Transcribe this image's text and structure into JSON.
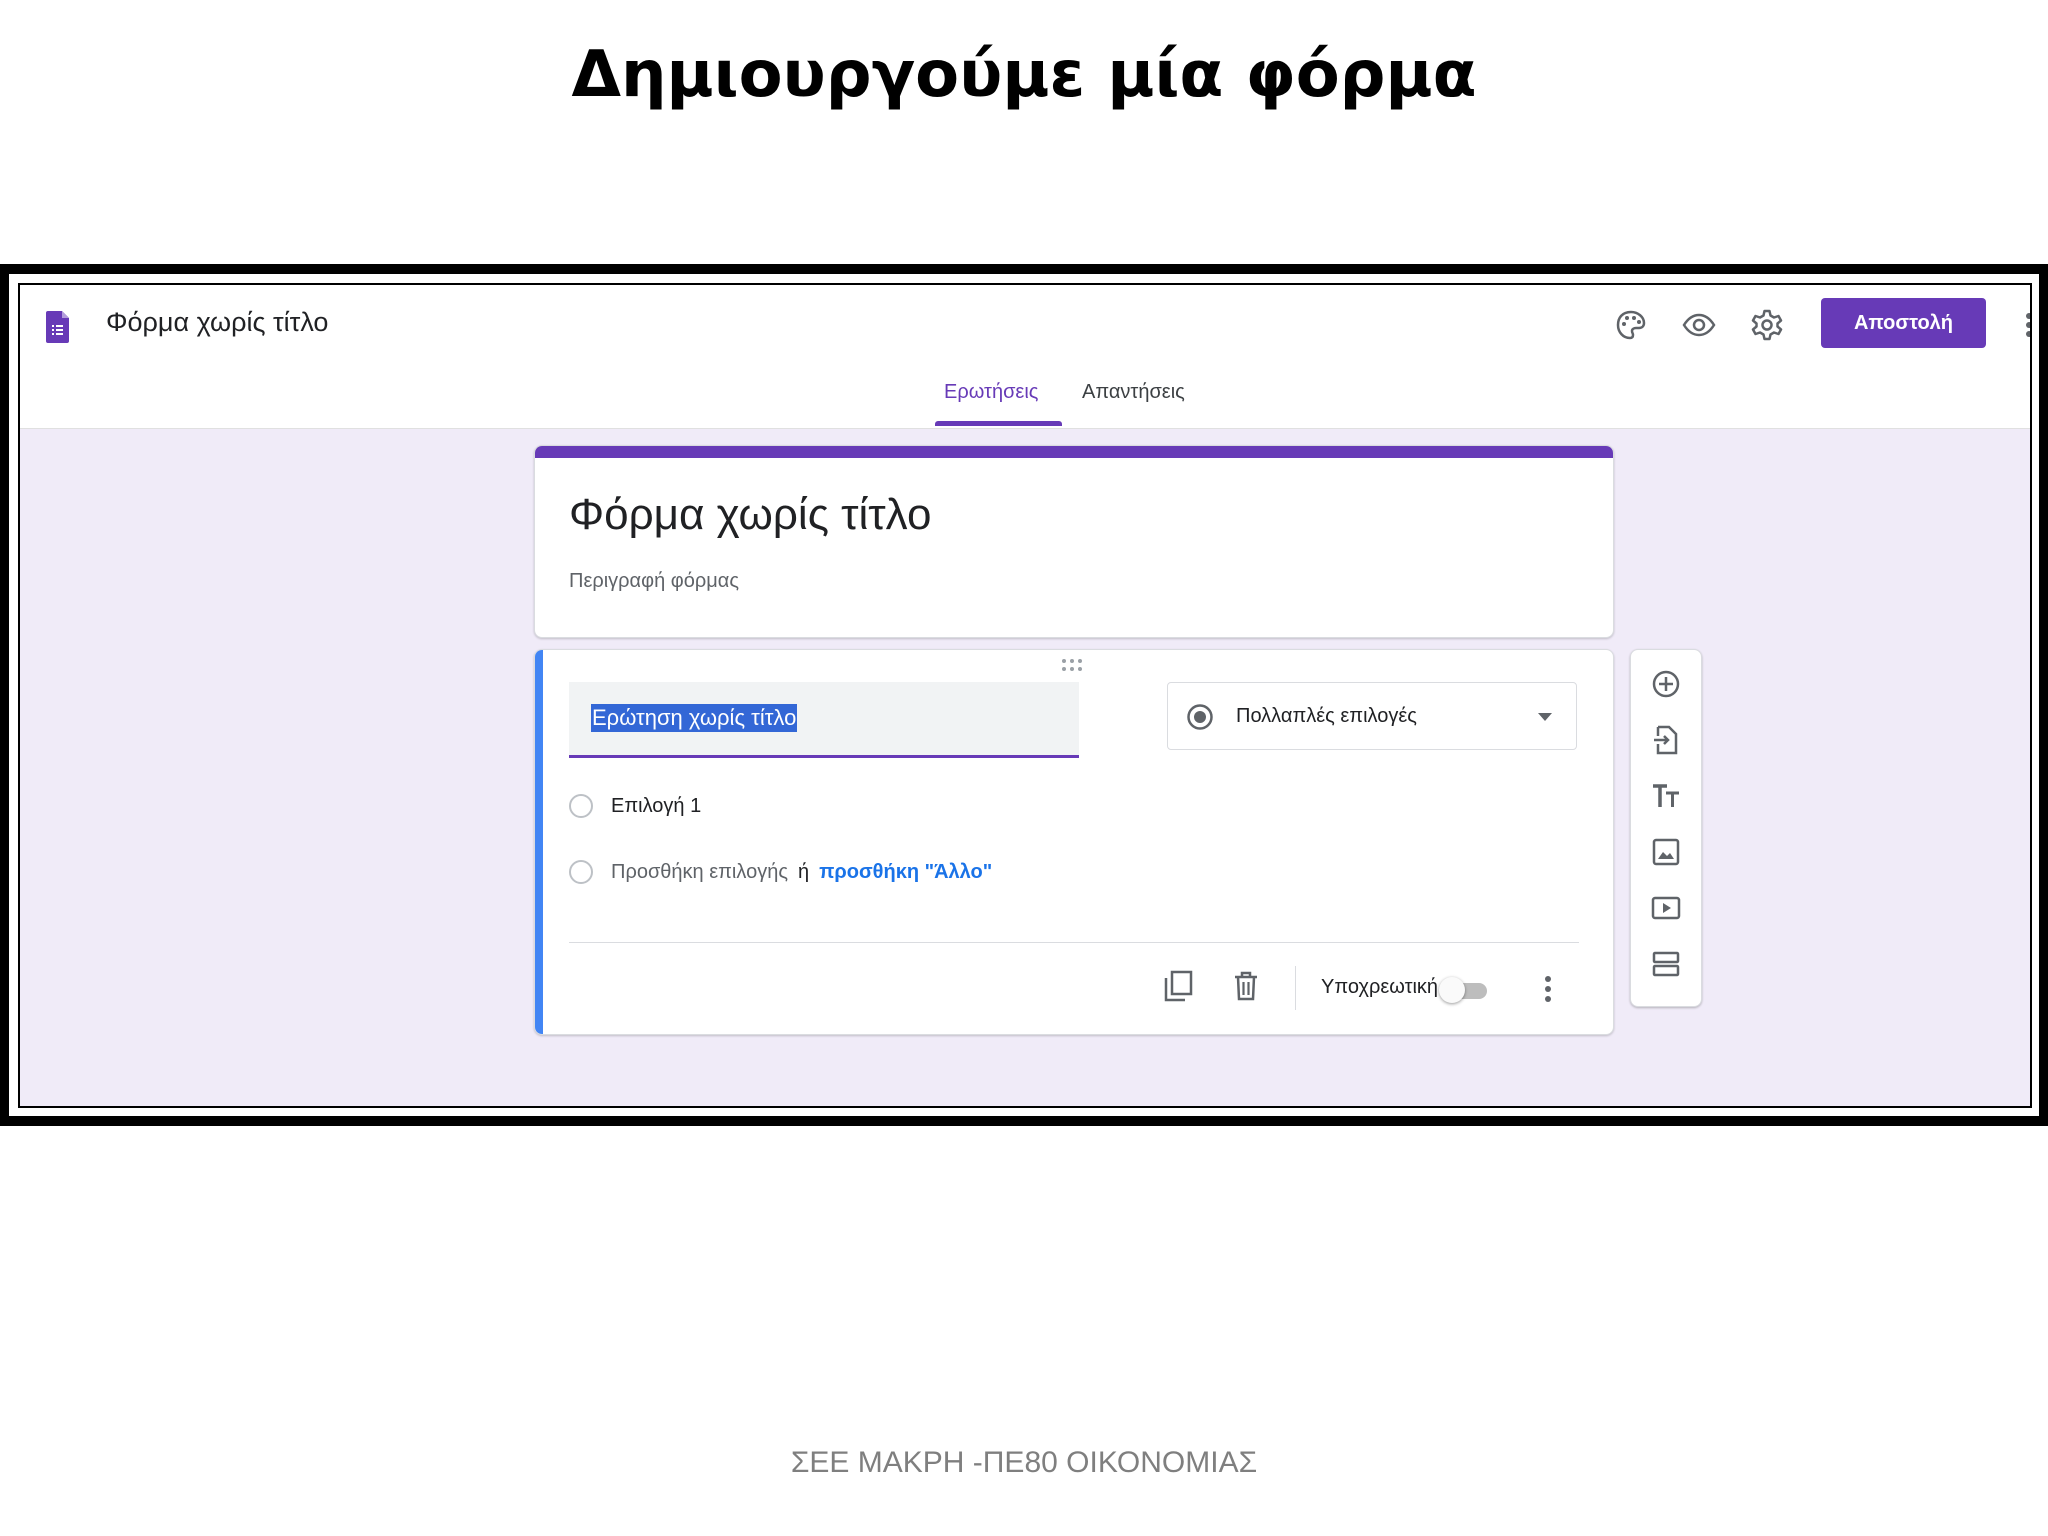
{
  "slide": {
    "title": "Δημιουργούμε μία φόρμα",
    "footer": "ΣΕΕ ΜΑΚΡΗ -ΠΕ80 ΟΙΚΟΝΟΜΙΑΣ"
  },
  "app": {
    "doc_title": "Φόρμα χωρίς τίτλο",
    "send_label": "Αποστολή",
    "accent_color": "#673ab7",
    "header_icons": [
      "palette-icon",
      "preview-eye-icon",
      "settings-gear-icon",
      "more-vert-icon"
    ]
  },
  "tabs": [
    {
      "label": "Ερωτήσεις",
      "active": true
    },
    {
      "label": "Απαντήσεις",
      "active": false
    }
  ],
  "form": {
    "title": "Φόρμα χωρίς τίτλο",
    "description_placeholder": "Περιγραφή φόρμας"
  },
  "question": {
    "text": "Ερώτηση χωρίς τίτλο",
    "type": "Πολλαπλές επιλογές",
    "option1": "Επιλογή 1",
    "add_option": "Προσθήκη επιλογής",
    "or": "ή",
    "add_other": "προσθήκη \"Άλλο\"",
    "required_label": "Υποχρεωτική",
    "required": false
  },
  "side_toolbar": [
    "add-question-icon",
    "import-questions-icon",
    "add-title-icon",
    "add-image-icon",
    "add-video-icon",
    "add-section-icon"
  ]
}
